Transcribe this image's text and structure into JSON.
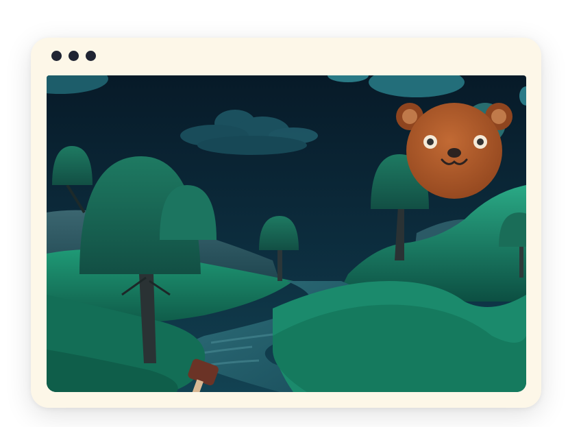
{
  "window": {
    "controls": [
      "dot",
      "dot",
      "dot"
    ]
  },
  "scene": {
    "time_of_day": "night",
    "theme_colors": {
      "sky": "#0c2838",
      "hills": "#14705a",
      "river": "#1e5a6a",
      "bear": "#b0582a",
      "frame": "#fdf7e8"
    }
  },
  "target": {
    "type": "bear",
    "icon": "bear-face-icon"
  },
  "tool": {
    "type": "mallet",
    "icon": "mallet-icon"
  }
}
